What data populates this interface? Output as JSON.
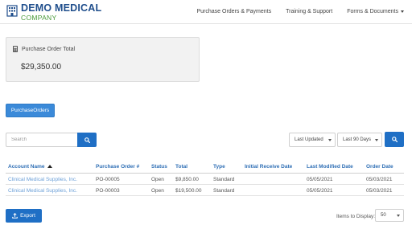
{
  "brand": {
    "title": "DEMO MEDICAL",
    "subtitle": "COMPANY"
  },
  "nav": {
    "items": [
      "Purchase Orders & Payments",
      "Training & Support",
      "Forms & Documents"
    ]
  },
  "summary": {
    "label": "Purchase Order Total",
    "value": "$29,350.00"
  },
  "purchase_orders_button": "PurchaseOrders",
  "search": {
    "placeholder": "Search"
  },
  "filters": {
    "sort_selected": "Last Updated",
    "range_selected": "Last 90 Days"
  },
  "table": {
    "columns": [
      "Account Name",
      "Purchase Order #",
      "Status",
      "Total",
      "Type",
      "Initial Receive Date",
      "Last Modified Date",
      "Order Date"
    ],
    "rows": [
      [
        "Clinical Medical Supplies, Inc.",
        "PO-00005",
        "Open",
        "$9,850.00",
        "Standard",
        "",
        "05/05/2021",
        "05/03/2021"
      ],
      [
        "Clinical Medical Supplies, Inc.",
        "PO-00003",
        "Open",
        "$19,500.00",
        "Standard",
        "",
        "05/05/2021",
        "05/03/2021"
      ]
    ]
  },
  "footer": {
    "export_label": "Export",
    "items_label": "Items to Display:",
    "items_value": "50"
  },
  "colors": {
    "primary": "#1f6fc5",
    "brand_blue": "#1f4e8c",
    "brand_green": "#4a9a3a",
    "link": "#6ea1d8"
  }
}
